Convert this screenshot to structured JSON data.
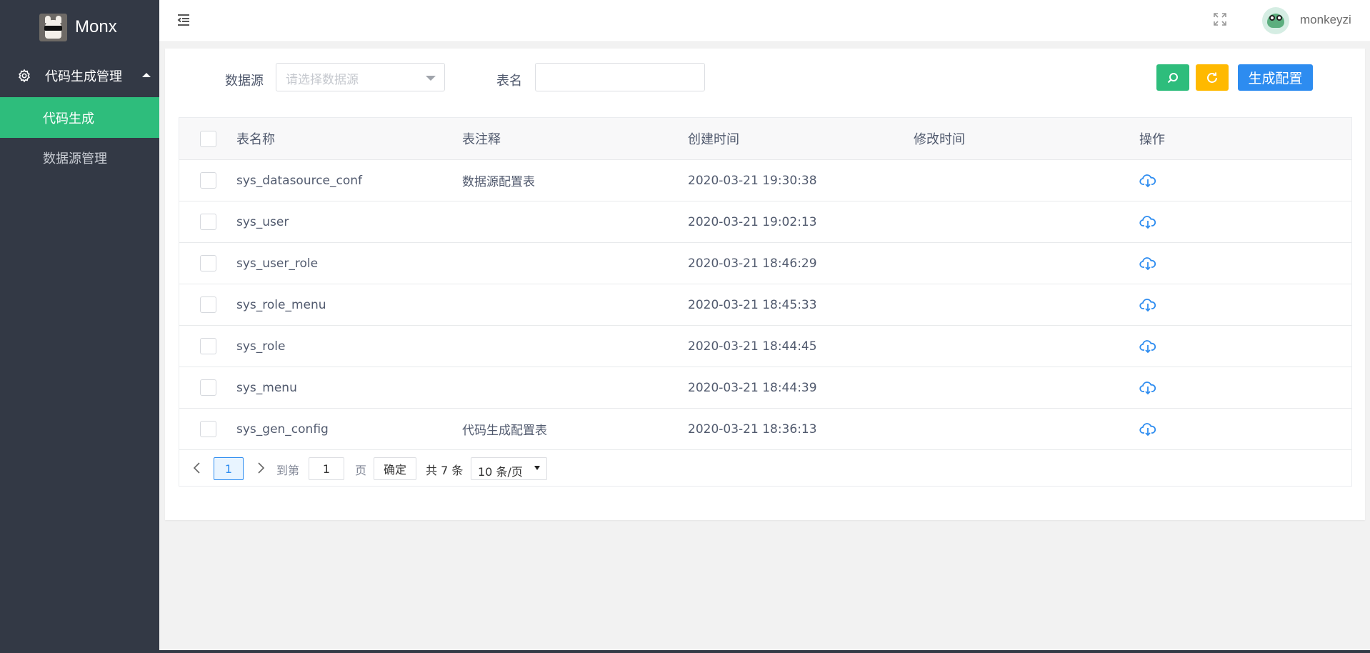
{
  "app": {
    "name": "Monx"
  },
  "sidebar": {
    "group_label": "代码生成管理",
    "items": [
      {
        "label": "代码生成",
        "active": true
      },
      {
        "label": "数据源管理",
        "active": false
      }
    ]
  },
  "header": {
    "username": "monkeyzi"
  },
  "filters": {
    "datasource_label": "数据源",
    "datasource_placeholder": "请选择数据源",
    "table_label": "表名",
    "table_value": "",
    "generate_label": "生成配置"
  },
  "table": {
    "columns": [
      "表名称",
      "表注释",
      "创建时间",
      "修改时间",
      "操作"
    ],
    "rows": [
      {
        "name": "sys_datasource_conf",
        "comment": "数据源配置表",
        "created": "2020-03-21 19:30:38",
        "modified": ""
      },
      {
        "name": "sys_user",
        "comment": "",
        "created": "2020-03-21 19:02:13",
        "modified": ""
      },
      {
        "name": "sys_user_role",
        "comment": "",
        "created": "2020-03-21 18:46:29",
        "modified": ""
      },
      {
        "name": "sys_role_menu",
        "comment": "",
        "created": "2020-03-21 18:45:33",
        "modified": ""
      },
      {
        "name": "sys_role",
        "comment": "",
        "created": "2020-03-21 18:44:45",
        "modified": ""
      },
      {
        "name": "sys_menu",
        "comment": "",
        "created": "2020-03-21 18:44:39",
        "modified": ""
      },
      {
        "name": "sys_gen_config",
        "comment": "代码生成配置表",
        "created": "2020-03-21 18:36:13",
        "modified": ""
      }
    ]
  },
  "pagination": {
    "current_page": "1",
    "goto_label": "到第",
    "goto_value": "1",
    "page_suffix": "页",
    "confirm_label": "确定",
    "total_label": "共 7 条",
    "page_size": "10 条/页"
  },
  "colors": {
    "sidebar_bg": "#333945",
    "accent_green": "#2ebd7c",
    "accent_yellow": "#ffb900",
    "accent_blue": "#2d8cf0"
  },
  "icons": [
    "menu-toggle-icon",
    "fullscreen-icon",
    "gear-icon",
    "search-icon",
    "refresh-icon",
    "cloud-download-icon",
    "chevron-left-icon",
    "chevron-right-icon"
  ]
}
